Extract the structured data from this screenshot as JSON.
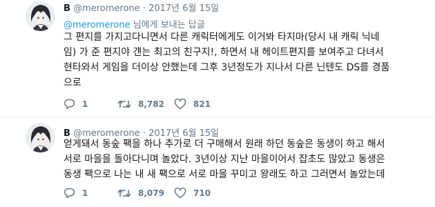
{
  "tweets": [
    {
      "name": "B",
      "handle": "@meromerone",
      "separator": "·",
      "date": "2017년 6월 15일",
      "reply_mention": "@meromerone",
      "reply_suffix": " 님에게 보내는 답글",
      "lines": [
        "그 편지를 가지고다니면서 다른 캐릭터에게도 이거봐 타지마(당시 내 캐릭 닉네",
        "임) 가 준 편지야 걘는 최고의 친구지!, 하면서 내 헤이트편지를 보여주고 다녀서",
        "현타와서 게임을 더이상 안했는데 그후 3년정도가 지나서 다른 닌텐도 DS를 경품",
        "으로"
      ],
      "replies": "1",
      "retweets": "8,782",
      "likes": "821"
    },
    {
      "name": "B",
      "handle": "@meromerone",
      "separator": "·",
      "date": "2017년 6월 15일",
      "lines": [
        "얻게돼서 동숲 팩을 하나 추가로 더 구매해서 원래 하던 동숲은 동생이 하고 해서",
        "서로 마을을 돌아다니며 놀았다. 3년이상 지난 마을이어서 잡초도 많았고 동생은",
        "동생 팩으로 나는 내 새 팩으로 서로 마을 꾸미고 왕래도 하고 그러면서 놀았는데"
      ],
      "replies": "1",
      "retweets": "8,079",
      "likes": "710"
    }
  ],
  "icons": {
    "reply": "reply-icon",
    "retweet": "retweet-icon",
    "like": "heart-icon"
  },
  "colors": {
    "text": "#14171a",
    "muted": "#657786",
    "link": "#1b95e0",
    "divider": "#e6ecf0"
  }
}
